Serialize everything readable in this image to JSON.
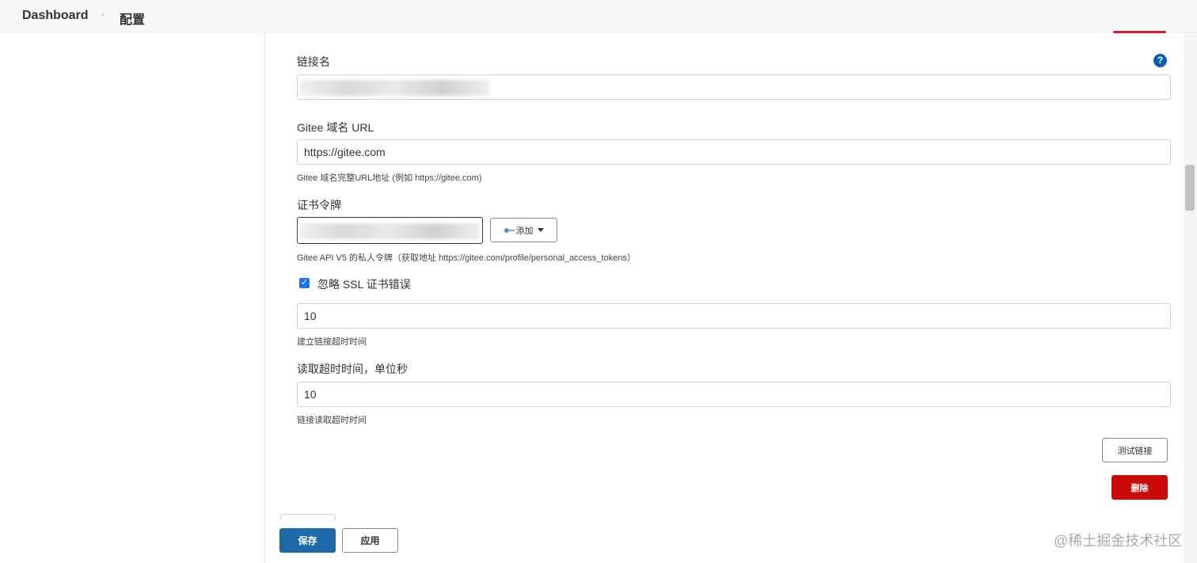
{
  "breadcrumb": {
    "root": "Dashboard",
    "separator": "›",
    "current": "配置"
  },
  "connection_name": {
    "label": "链接名",
    "help_icon": "?"
  },
  "gitee_url": {
    "label": "Gitee 域名 URL",
    "value": "https://gitee.com",
    "hint": "Gitee 域名完整URL地址 (例如 https://gitee.com)"
  },
  "credentials": {
    "label": "证书令牌",
    "add_button": "添加",
    "hint": "Gitee API V5 的私人令牌（获取地址 https://gitee.com/profile/personal_access_tokens）"
  },
  "ignore_ssl": {
    "checked": true,
    "label": "忽略 SSL 证书错误"
  },
  "connect_timeout": {
    "value": "10",
    "hint": "建立链接超时时间"
  },
  "read_timeout": {
    "label": "读取超时时间，单位秒",
    "value": "10",
    "hint": "链接读取超时时间"
  },
  "actions": {
    "test_connection": "测试链接",
    "delete": "删除"
  },
  "footer": {
    "save": "保存",
    "apply": "应用"
  },
  "watermark": "@稀土掘金技术社区",
  "colors": {
    "primary": "#1e6aa8",
    "danger": "#cc0a0a",
    "help": "#0d5ea8",
    "checkbox": "#1a73e8"
  },
  "icons": {
    "help": "help-icon",
    "key": "key-icon",
    "caret": "chevron-down-icon",
    "check": "checkmark-icon"
  }
}
